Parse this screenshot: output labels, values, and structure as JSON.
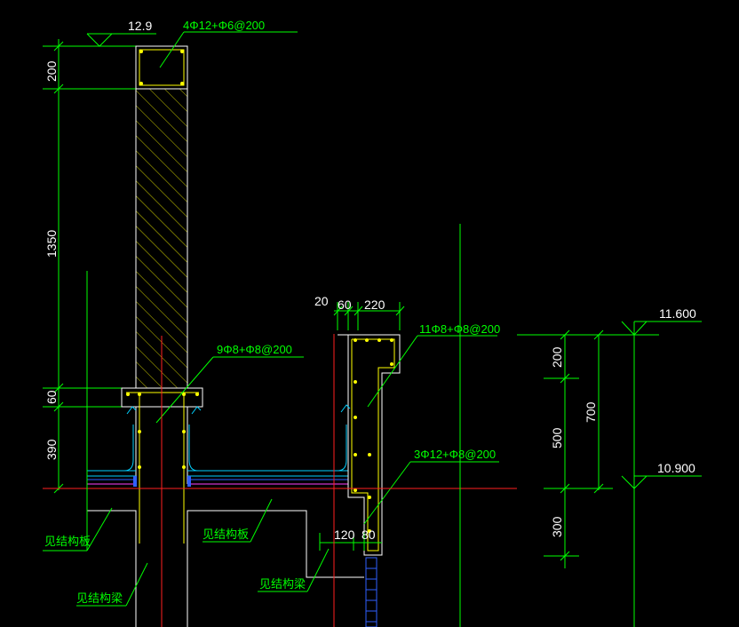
{
  "elevations": {
    "top": "12.9",
    "roof": "11.600",
    "slab": "10.900"
  },
  "rebar_labels": {
    "parapet_cap": "4Φ12+Φ6@200",
    "upturn_beam": "9Φ8+Φ8@200",
    "gutter_wall": "11Φ8+Φ8@200",
    "gutter_bottom": "3Φ12+Φ8@200"
  },
  "dims_left": {
    "d200": "200",
    "d1350": "1350",
    "d60": "60",
    "d390": "390"
  },
  "dims_right": {
    "d200": "200",
    "d500": "500",
    "d300": "300",
    "d700": "700"
  },
  "dims_gutter": {
    "d20": "20",
    "d60": "60",
    "d220": "220",
    "d120": "120",
    "d80": "80"
  },
  "notes": {
    "see_struct_slab_1": "见结构板",
    "see_struct_slab_2": "见结构板",
    "see_struct_beam_1": "见结构梁",
    "see_struct_beam_2": "见结构梁"
  },
  "colors": {
    "background": "#000000",
    "dimension": "#00ff00",
    "outline": "#ffffff",
    "rebar": "#ffff00",
    "axis": "#ff2020",
    "waterproof": "#00d0ff"
  }
}
